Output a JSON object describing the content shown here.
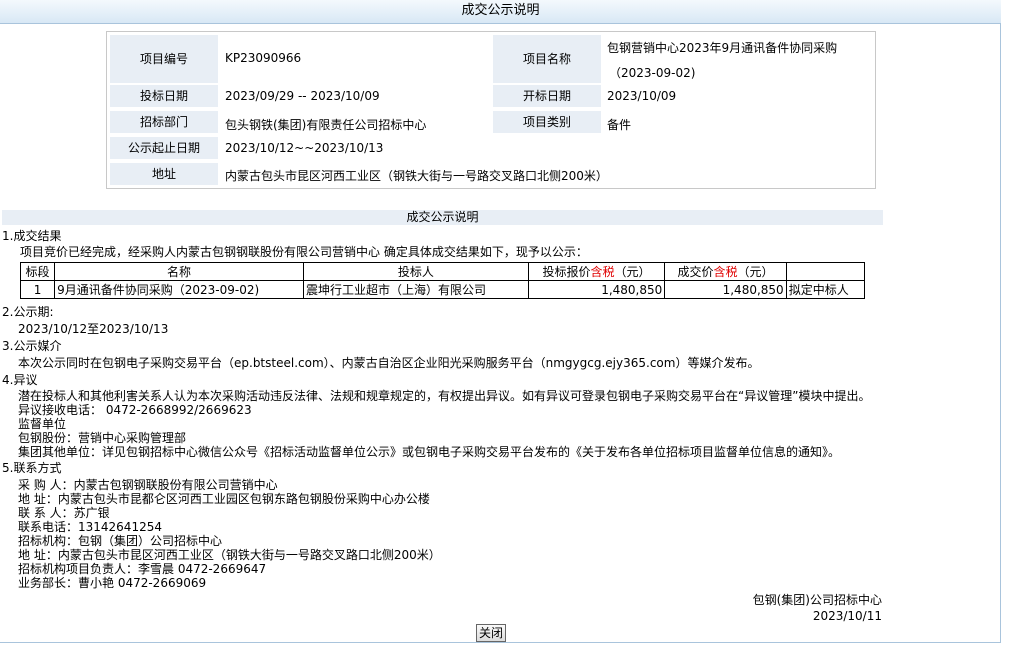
{
  "window": {
    "title": "成交公示说明"
  },
  "info": {
    "project_no_label": "项目编号",
    "project_no": "KP23090966",
    "project_name_label": "项目名称",
    "project_name_line1": "包钢营销中心2023年9月通讯备件协同采购",
    "project_name_line2": "（2023-09-02)",
    "bid_date_label": "投标日期",
    "bid_date": "2023/09/29 -- 2023/10/09",
    "open_date_label": "开标日期",
    "open_date": "2023/10/09",
    "dept_label": "招标部门",
    "dept": "包头钢铁(集团)有限责任公司招标中心",
    "category_label": "项目类别",
    "category": "备件",
    "notice_period_label": "公示起止日期",
    "notice_period": "2023/10/12~~2023/10/13",
    "address_label": "地址",
    "address": "内蒙古包头市昆区河西工业区（钢铁大街与一号路交叉路口北侧200米）"
  },
  "section_title": "成交公示说明",
  "result": {
    "heading": "1.成交结果",
    "intro": "项目竞价已经完成，经采购人内蒙古包钢钢联股份有限公司营销中心 确定具体成交结果如下，现予以公示：",
    "headers": {
      "seg": "标段",
      "name": "名称",
      "bidder": "投标人",
      "quote_a": "投标报价",
      "quote_red": "含税",
      "quote_b": "（元）",
      "deal_a": "成交价",
      "deal_red": "含税",
      "deal_b": "（元）"
    },
    "rows": [
      {
        "seg": "1",
        "name": "9月通讯备件协同采购（2023-09-02)",
        "bidder": "震坤行工业超市（上海）有限公司",
        "quote": "1,480,850",
        "deal": "1,480,850",
        "status": "拟定中标人"
      }
    ]
  },
  "period": {
    "heading": "2.公示期:",
    "value": "2023/10/12至2023/10/13"
  },
  "media": {
    "heading": "3.公示媒介",
    "value": "本次公示同时在包钢电子采购交易平台（ep.btsteel.com）、内蒙古自治区企业阳光采购服务平台（nmgygcg.ejy365.com）等媒介发布。"
  },
  "objection": {
    "heading": "4.异议",
    "line1": "潜在投标人和其他利害关系人认为本次采购活动违反法律、法规和规章规定的，有权提出异议。如有异议可登录包钢电子采购交易平台在“异议管理”模块中提出。",
    "line2": "异议接收电话：  0472-2668992/2669623",
    "line3": "监督单位",
    "line4": "包钢股份：营销中心采购管理部",
    "line5": "集团其他单位：详见包钢招标中心微信公众号《招标活动监督单位公示》或包钢电子采购交易平台发布的《关于发布各单位招标项目监督单位信息的通知》。"
  },
  "contact": {
    "heading": "5.联系方式",
    "lines": [
      "采 购 人：内蒙古包钢钢联股份有限公司营销中心",
      "地 址：内蒙古包头市昆都仑区河西工业园区包钢东路包钢股份采购中心办公楼",
      "联 系 人：苏广银",
      "联系电话：13142641254",
      "招标机构：包钢（集团）公司招标中心",
      "地 址：内蒙古包头市昆区河西工业区（钢铁大街与一号路交叉路口北侧200米）",
      "招标机构项目负责人：李雪晨 0472-2669647",
      "业务部长：曹小艳 0472-2669069"
    ]
  },
  "signature": {
    "org": "包钢(集团)公司招标中心",
    "date": "2023/10/11"
  },
  "close_button": "关闭"
}
